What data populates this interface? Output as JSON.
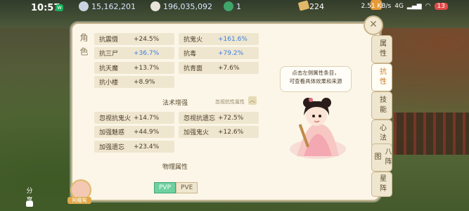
{
  "status_bar": {
    "time": "10:57",
    "wechat_glyph": "w",
    "resources": [
      {
        "icon": "silver-coin-icon",
        "value": "15,162,201"
      },
      {
        "icon": "gold-coin-icon",
        "value": "196,035,092"
      },
      {
        "icon": "jade-icon",
        "value": "1"
      },
      {
        "icon": "scroll-icon",
        "value": "224"
      }
    ],
    "network": "2.51 KB/s",
    "network_type": "4G",
    "signal": "▂▄▆",
    "wifi": "wifi-icon",
    "battery": "13"
  },
  "panel": {
    "side_tab": "角色",
    "resist_rows": [
      {
        "name": "抗震慑",
        "value": "+24.5%",
        "color": "normal"
      },
      {
        "name": "抗鬼火",
        "value": "+161.6%",
        "color": "blue"
      },
      {
        "name": "抗三尸",
        "value": "+36.7%",
        "color": "blue"
      },
      {
        "name": "抗毒",
        "value": "+79.2%",
        "color": "blue"
      },
      {
        "name": "抗天魔",
        "value": "+13.7%",
        "color": "normal"
      },
      {
        "name": "抗青面",
        "value": "+7.6%",
        "color": "normal"
      },
      {
        "name": "抗小楼",
        "value": "+8.9%",
        "color": "normal"
      }
    ],
    "section_spell": {
      "title": "法术增强",
      "sub": "忽视抗性属性",
      "chevron": "︿"
    },
    "spell_rows": [
      {
        "name": "忽视抗鬼火",
        "value": "+14.7%"
      },
      {
        "name": "忽视抗遗忘",
        "value": "+72.5%"
      },
      {
        "name": "加强魅惑",
        "value": "+44.9%"
      },
      {
        "name": "加强鬼火",
        "value": "+12.6%"
      },
      {
        "name": "加强遗忘",
        "value": "+23.4%"
      }
    ],
    "section_phys": {
      "title": "物理属性"
    },
    "hint": "点击左侧属性条目，\n可查看具体效果和来源",
    "close_glyph": "✕"
  },
  "right_tabs": [
    {
      "label": "属性",
      "active": false
    },
    {
      "label": "抗性",
      "active": true
    },
    {
      "label": "技能",
      "active": false
    },
    {
      "label": "心法",
      "active": false
    },
    {
      "label": "八阵图",
      "active": false
    },
    {
      "label": "星阵",
      "active": false
    }
  ],
  "modes": {
    "pvp": "PVP",
    "pve": "PVE",
    "active": "pvp"
  },
  "bottom": {
    "avatar_label": "阿瞳鸳",
    "share": "分享"
  },
  "colors": {
    "accent_blue": "#3c7fe0",
    "accent_orange": "#c97a2a",
    "panel_bg": "#fbf6e8",
    "row_bg": "#efe6cf"
  }
}
